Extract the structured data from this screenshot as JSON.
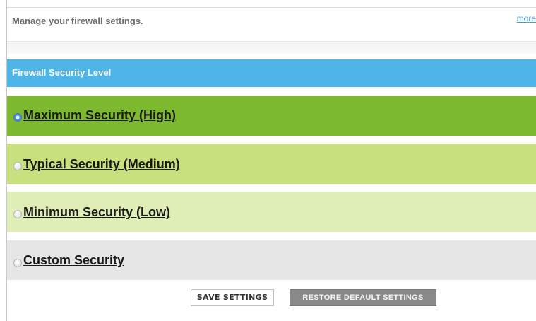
{
  "header": {
    "text": "Manage your firewall settings.",
    "more_link": "more"
  },
  "section": {
    "title": "Firewall Security Level"
  },
  "options": [
    {
      "label": "Maximum Security (High)",
      "selected": true
    },
    {
      "label": "Typical Security (Medium)",
      "selected": false
    },
    {
      "label": "Minimum Security (Low)",
      "selected": false
    },
    {
      "label": "Custom Security",
      "selected": false
    }
  ],
  "buttons": {
    "save": "SAVE SETTINGS",
    "restore": "RESTORE DEFAULT SETTINGS"
  },
  "colors": {
    "section_header": "#4fb4e8",
    "high": "#7eba2f",
    "medium": "#c8e07e",
    "low": "#dfedb6",
    "custom": "#e6e6e6",
    "restore_button": "#8a8a8a"
  }
}
